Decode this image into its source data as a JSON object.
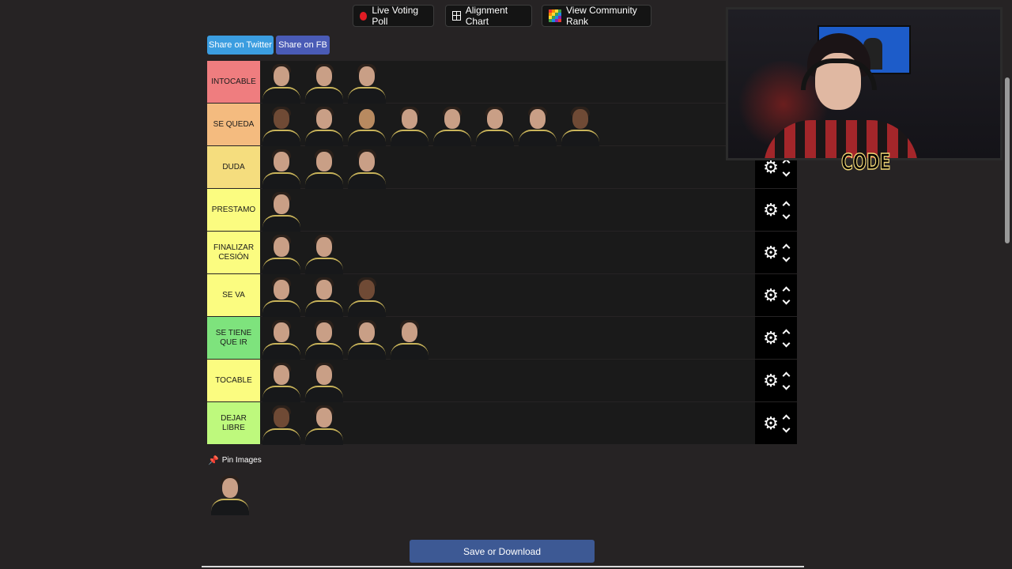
{
  "toolbar": {
    "live_poll": "Live Voting Poll",
    "alignment": "Alignment Chart",
    "community": "View Community Rank"
  },
  "share": {
    "twitter": "Share on Twitter",
    "fb": "Share on FB"
  },
  "tiers": [
    {
      "label": "INTOCABLE",
      "color": "#ef7d7f",
      "players": 3
    },
    {
      "label": "SE QUEDA",
      "color": "#f4bb7f",
      "players": 8
    },
    {
      "label": "DUDA",
      "color": "#f5dd7e",
      "players": 3
    },
    {
      "label": "PRESTAMO",
      "color": "#fbfc80",
      "players": 1
    },
    {
      "label": "FINALIZAR CESIÓN",
      "color": "#fbfc80",
      "players": 2
    },
    {
      "label": "SE VA",
      "color": "#fbfc80",
      "players": 3
    },
    {
      "label": "SE TIENE QUE IR",
      "color": "#7ee37d",
      "players": 4
    },
    {
      "label": "TOCABLE",
      "color": "#fbfc80",
      "players": 2
    },
    {
      "label": "DEJAR LIBRE",
      "color": "#bef97d",
      "players": 2
    }
  ],
  "pin": {
    "label": "Pin Images",
    "icon": "pushpin-icon"
  },
  "pool": {
    "players": 1
  },
  "save": "Save or Download",
  "webcam": {
    "overlay_text": "CODE"
  },
  "colors": {
    "background": "#262324",
    "save_button": "#3d5994",
    "twitter": "#3b9de0",
    "fb": "#4a5bb6"
  }
}
